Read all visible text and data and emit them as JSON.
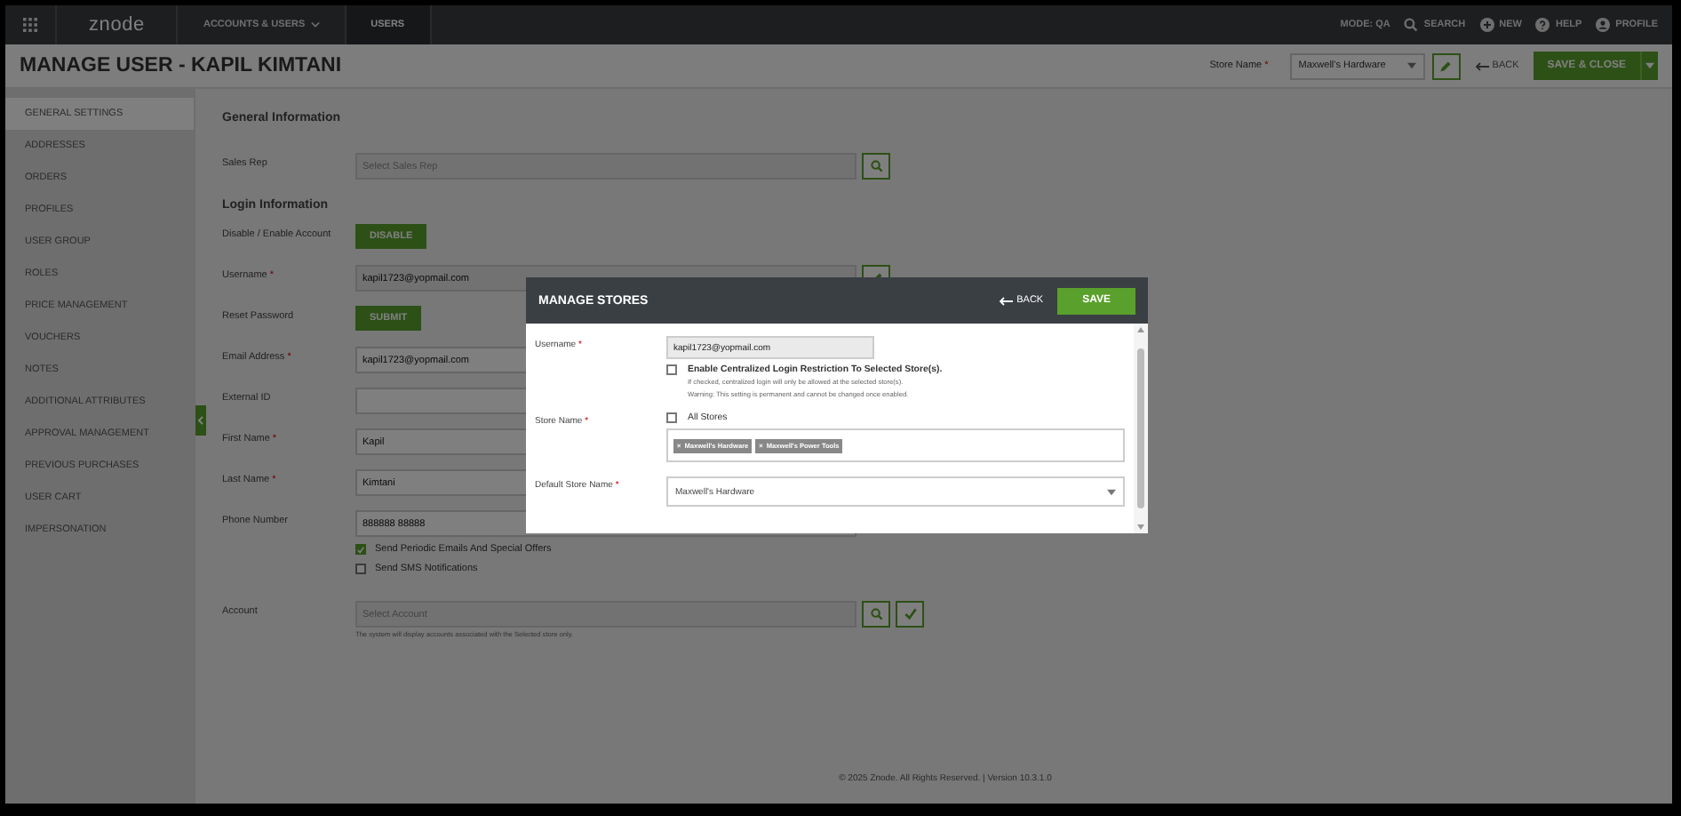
{
  "topbar": {
    "logo": "znode",
    "nav": [
      {
        "label": "ACCOUNTS & USERS",
        "dropdown": true,
        "selected": false
      },
      {
        "label": "USERS",
        "dropdown": false,
        "selected": true
      }
    ],
    "mode": "MODE: QA",
    "actions": [
      {
        "kind": "search",
        "label": "SEARCH"
      },
      {
        "kind": "new",
        "label": "NEW"
      },
      {
        "kind": "help",
        "label": "HELP"
      },
      {
        "kind": "profile",
        "label": "PROFILE"
      }
    ]
  },
  "header": {
    "title": "MANAGE USER - KAPIL KIMTANI",
    "store_label": "Store Name",
    "required_mark": "*",
    "store_value": "Maxwell's Hardware",
    "back": "BACK",
    "save": "SAVE & CLOSE"
  },
  "sidebar": {
    "items": [
      {
        "label": "GENERAL SETTINGS",
        "selected": true
      },
      {
        "label": "ADDRESSES",
        "selected": false
      },
      {
        "label": "ORDERS",
        "selected": false
      },
      {
        "label": "PROFILES",
        "selected": false
      },
      {
        "label": "USER GROUP",
        "selected": false
      },
      {
        "label": "ROLES",
        "selected": false
      },
      {
        "label": "PRICE MANAGEMENT",
        "selected": false
      },
      {
        "label": "VOUCHERS",
        "selected": false
      },
      {
        "label": "NOTES",
        "selected": false
      },
      {
        "label": "ADDITIONAL ATTRIBUTES",
        "selected": false
      },
      {
        "label": "APPROVAL MANAGEMENT",
        "selected": false
      },
      {
        "label": "PREVIOUS PURCHASES",
        "selected": false
      },
      {
        "label": "USER CART",
        "selected": false
      },
      {
        "label": "IMPERSONATION",
        "selected": false
      }
    ]
  },
  "form": [
    {
      "kind": "heading",
      "text": "General Information"
    },
    {
      "kind": "field",
      "label": "Sales Rep",
      "placeholder": "Select Sales Rep",
      "readonly": true,
      "search_button": true
    },
    {
      "kind": "heading",
      "text": "Login Information"
    },
    {
      "kind": "button",
      "label": "Disable / Enable Account",
      "button": "DISABLE"
    },
    {
      "kind": "field",
      "label": "Username",
      "required_mark": "*",
      "value": "kapil1723@yopmail.com",
      "readonly": true,
      "edit_button": true
    },
    {
      "kind": "button",
      "label": "Reset Password",
      "button": "SUBMIT"
    },
    {
      "kind": "field",
      "label": "Email Address",
      "required_mark": "*",
      "value": "kapil1723@yopmail.com",
      "readonly": false
    },
    {
      "kind": "field",
      "label": "External ID",
      "readonly": false
    },
    {
      "kind": "field",
      "label": "First Name",
      "required_mark": "*",
      "value": "Kapil",
      "readonly": false
    },
    {
      "kind": "field",
      "label": "Last Name",
      "required_mark": "*",
      "value": "Kimtani",
      "readonly": false
    },
    {
      "kind": "field",
      "label": "Phone Number",
      "value": "888888 88888",
      "readonly": false
    },
    {
      "kind": "checkbox",
      "label": "Send Periodic Emails And Special Offers",
      "checked": true
    },
    {
      "kind": "checkbox",
      "label": "Send SMS Notifications",
      "checked": false
    },
    {
      "kind": "field",
      "label": "Account",
      "placeholder": "Select Account",
      "readonly": true,
      "search_button": true,
      "check_button": true,
      "hint": "The system will display accounts associated with the Selected store only."
    }
  ],
  "footer": "© 2025 Znode. All Rights Reserved. | Version 10.3.1.0",
  "modal": {
    "title": "MANAGE STORES",
    "back": "BACK",
    "save": "SAVE",
    "username": {
      "label": "Username",
      "required_mark": "*",
      "value": "kapil1723@yopmail.com"
    },
    "restriction": {
      "label": "Enable Centralized Login Restriction To Selected Store(s).",
      "checked": false,
      "note": "If checked, centralized login will only be allowed at the selected store(s).",
      "warning": "Warning: This setting is permanent and cannot be changed once enabled."
    },
    "store": {
      "label": "Store Name",
      "required_mark": "*",
      "all_label": "All Stores",
      "all_checked": false,
      "tags": [
        {
          "remove": "×",
          "label": "Maxwell's Hardware"
        },
        {
          "remove": "×",
          "label": "Maxwell's Power Tools"
        }
      ]
    },
    "default_store": {
      "label": "Default Store Name",
      "required_mark": "*",
      "value": "Maxwell's Hardware"
    }
  }
}
